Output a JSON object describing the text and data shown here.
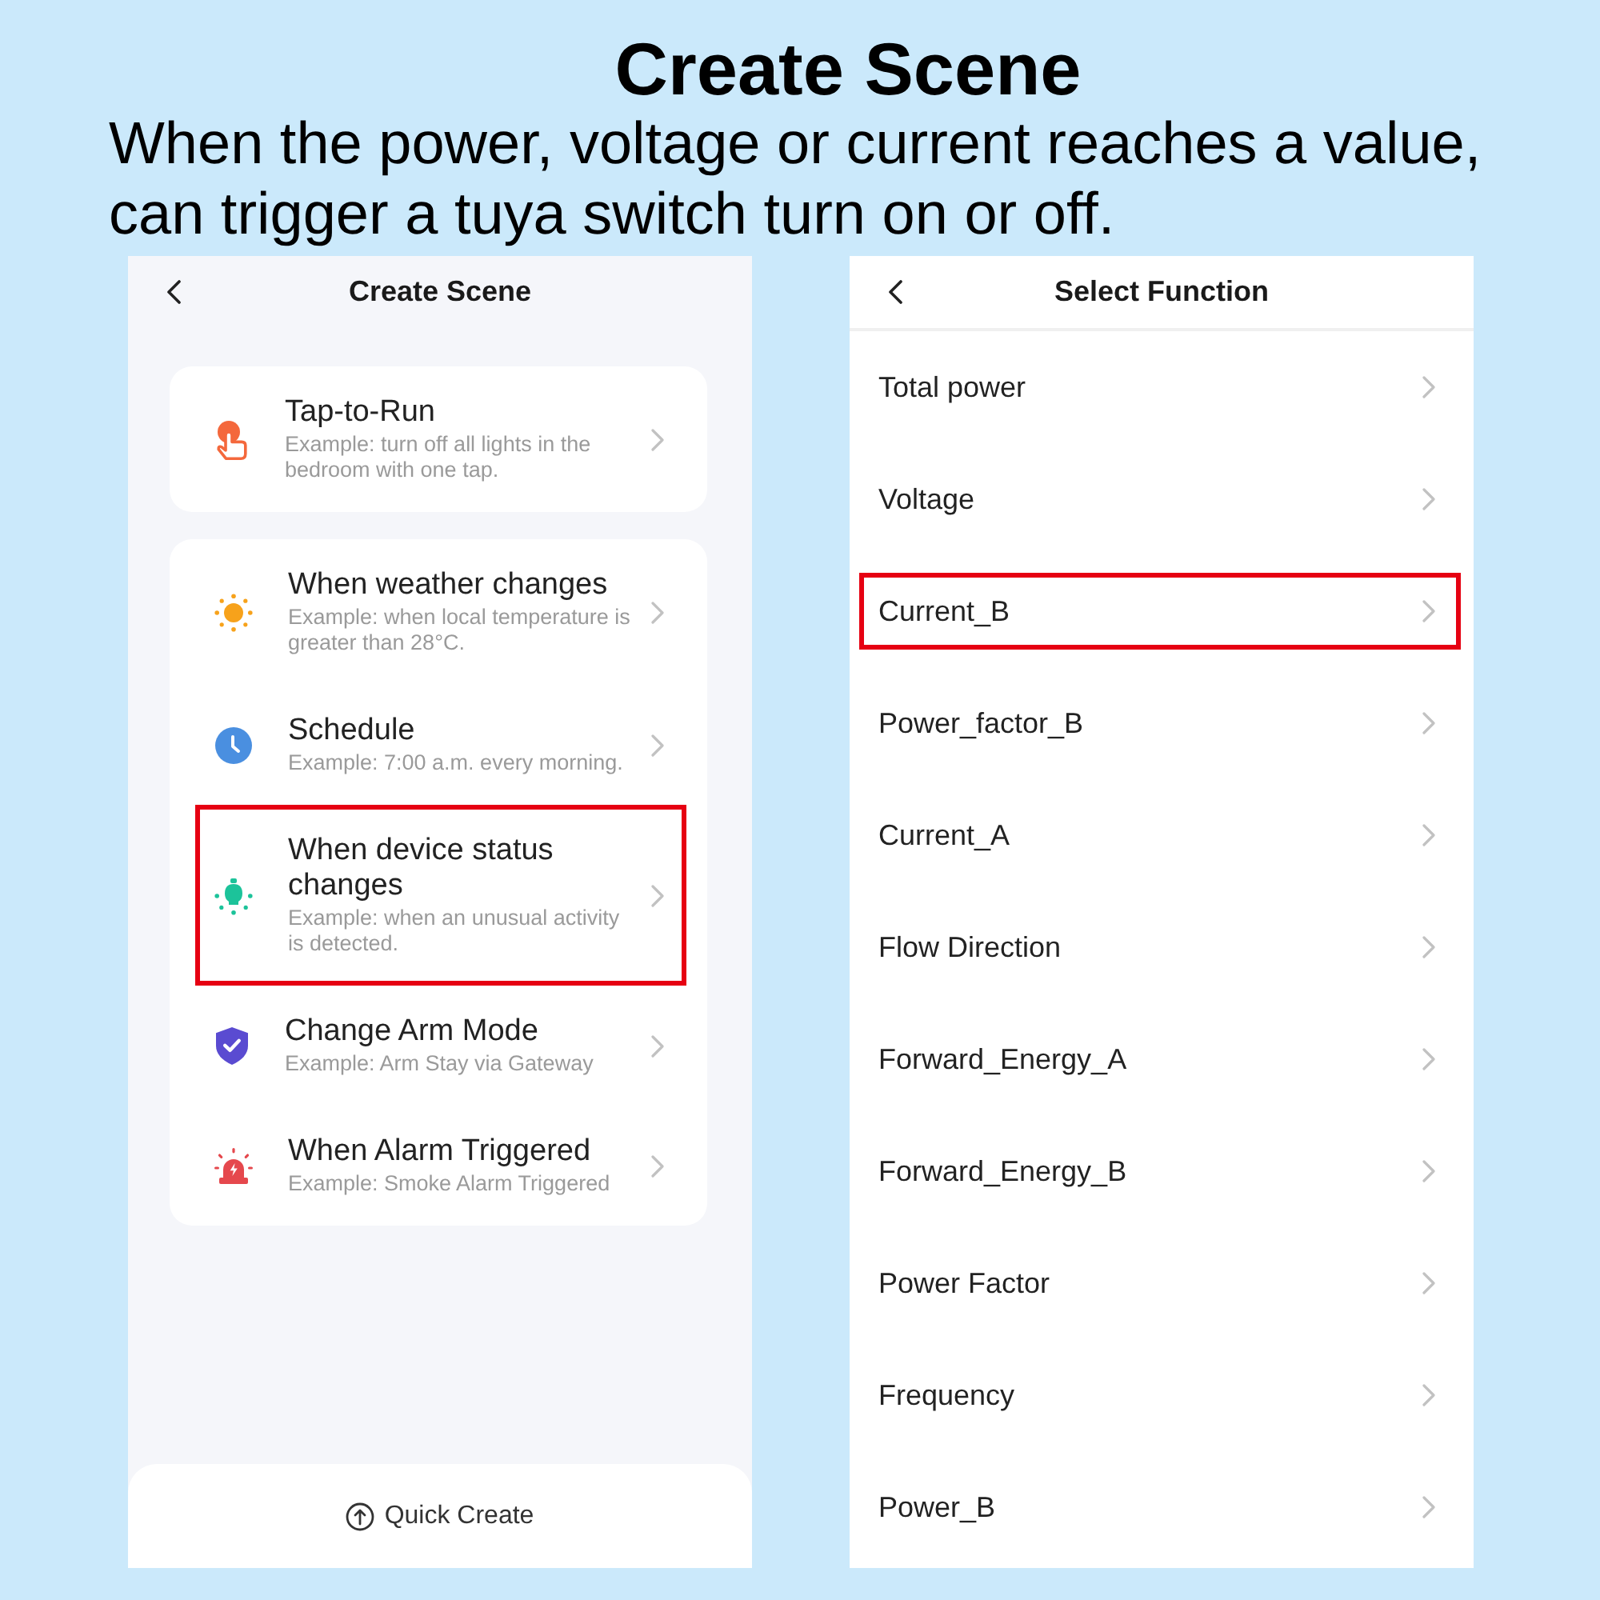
{
  "banner": {
    "title": "Create Scene",
    "description": "When the power, voltage or current reaches a value, can trigger a tuya switch turn on or off."
  },
  "create_scene": {
    "title": "Create Scene",
    "groups": [
      {
        "items": [
          {
            "kind": "tap",
            "title": "Tap-to-Run",
            "description": "Example: turn off all lights in the bedroom with one tap.",
            "highlighted": false
          }
        ]
      },
      {
        "items": [
          {
            "kind": "weather",
            "title": "When weather changes",
            "description": "Example: when local temperature is greater than 28°C.",
            "highlighted": false
          },
          {
            "kind": "schedule",
            "title": "Schedule",
            "description": "Example: 7:00 a.m. every morning.",
            "highlighted": false
          },
          {
            "kind": "device",
            "title": "When device status changes",
            "description": "Example: when an unusual activity is detected.",
            "highlighted": true
          },
          {
            "kind": "arm",
            "title": "Change Arm Mode",
            "description": "Example: Arm Stay via Gateway",
            "highlighted": false
          },
          {
            "kind": "alarm",
            "title": "When Alarm Triggered",
            "description": "Example: Smoke Alarm Triggered",
            "highlighted": false
          }
        ]
      }
    ],
    "quick_create": "Quick Create"
  },
  "select_function": {
    "title": "Select Function",
    "items": [
      {
        "label": "Total power",
        "highlighted": false
      },
      {
        "label": "Voltage",
        "highlighted": false
      },
      {
        "label": "Current_B",
        "highlighted": true
      },
      {
        "label": "Power_factor_B",
        "highlighted": false
      },
      {
        "label": "Current_A",
        "highlighted": false
      },
      {
        "label": "Flow Direction",
        "highlighted": false
      },
      {
        "label": "Forward_Energy_A",
        "highlighted": false
      },
      {
        "label": "Forward_Energy_B",
        "highlighted": false
      },
      {
        "label": "Power Factor",
        "highlighted": false
      },
      {
        "label": "Frequency",
        "highlighted": false
      },
      {
        "label": "Power_B",
        "highlighted": false
      }
    ]
  }
}
